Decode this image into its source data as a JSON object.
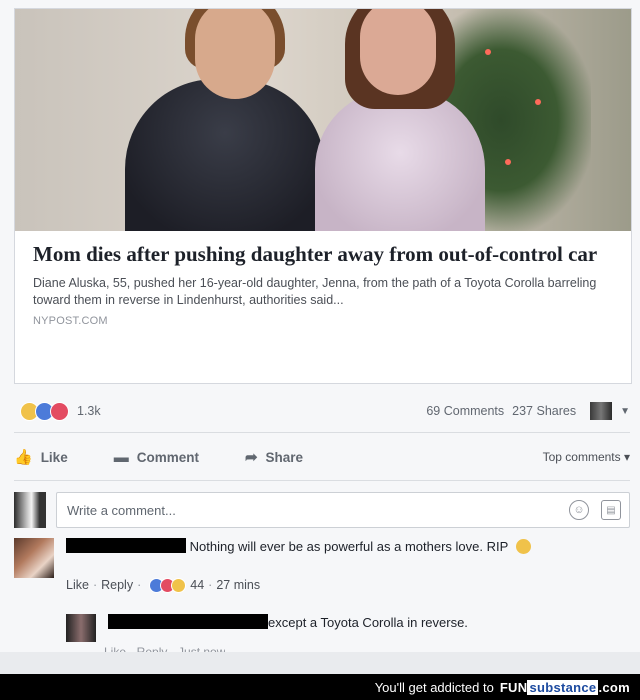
{
  "link_preview": {
    "headline": "Mom dies after pushing daughter away from out-of-control car",
    "description": "Diane Aluska, 55, pushed her 16-year-old daughter, Jenna, from the path of a Toyota Corolla barreling toward them in reverse in Lindenhurst, authorities said...",
    "domain": "NYPOST.COM"
  },
  "stats": {
    "reaction_count": "1.3k",
    "comments": "69 Comments",
    "shares": "237 Shares"
  },
  "actions": {
    "like": "Like",
    "comment": "Comment",
    "share": "Share",
    "top_comments": "Top comments ▾"
  },
  "compose": {
    "placeholder": "Write a comment..."
  },
  "comments": [
    {
      "text": "Nothing will ever be as powerful as a mothers love. RIP",
      "like": "Like",
      "reply": "Reply",
      "reaction_count": "44",
      "time": "27 mins"
    },
    {
      "text": "except a Toyota Corolla in reverse.",
      "meta_partial": "Like · Reply · Just now"
    }
  ],
  "footer": {
    "tagline": "You'll get addicted to",
    "brand_a": "FUN",
    "brand_b": "substance",
    "brand_c": ".com"
  },
  "colors": {
    "reaction_sad": "#f0c24a",
    "reaction_like": "#4c7bd9",
    "reaction_love": "#e34b62"
  }
}
